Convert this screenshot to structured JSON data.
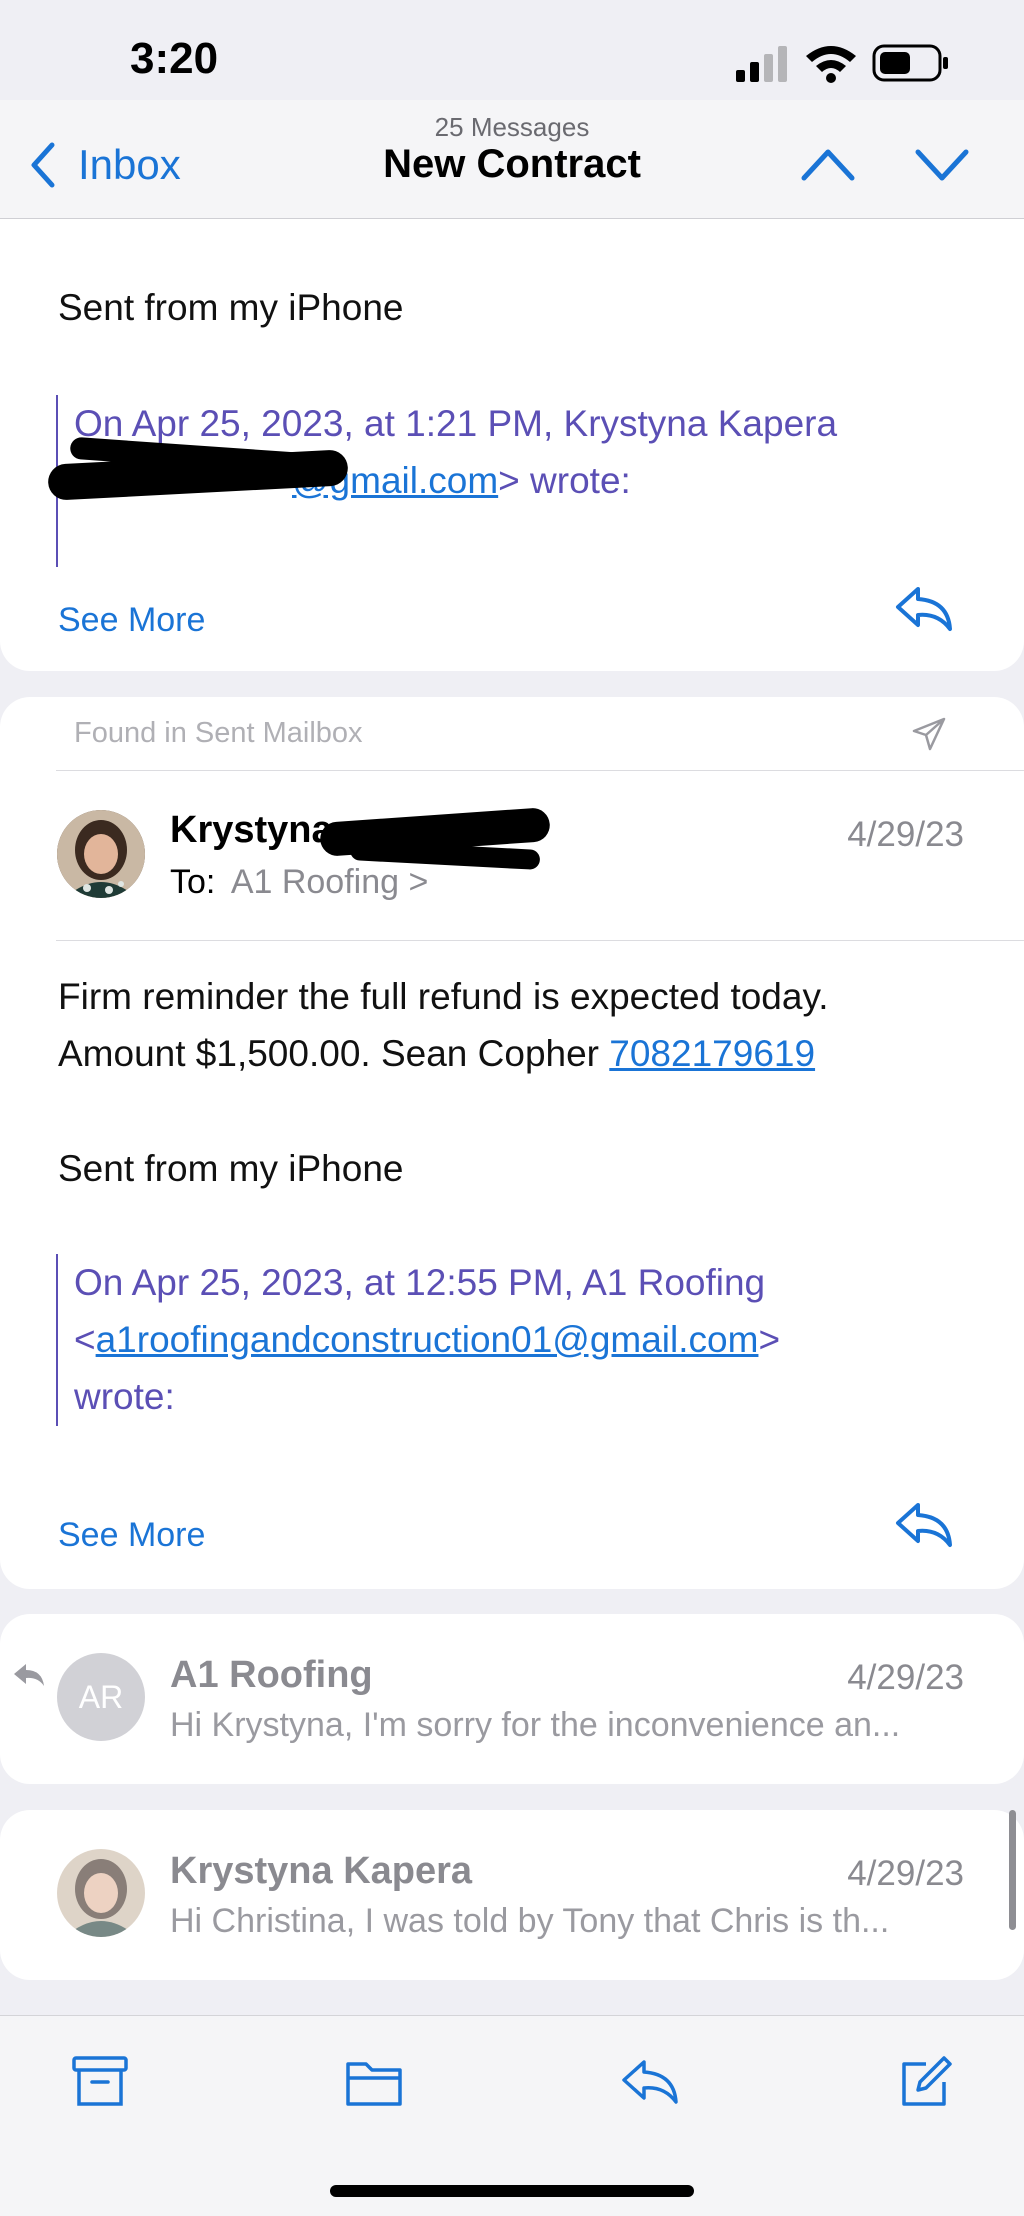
{
  "status": {
    "time": "3:20"
  },
  "nav": {
    "back_label": "Inbox",
    "message_count": "25 Messages",
    "title": "New Contract"
  },
  "msg1": {
    "signature": "Sent from my iPhone",
    "quote_line1": "On Apr 25, 2023, at 1:21 PM, Krystyna Kapera",
    "quote_link": "@gmail.com",
    "quote_tail": "> wrote:",
    "see_more": "See More"
  },
  "msg2": {
    "found_in": "Found in Sent Mailbox",
    "sender": "Krystyna",
    "date": "4/29/23",
    "to_label": "To:",
    "to_value": "A1 Roofing >",
    "body_line1": "Firm reminder the full refund is expected today.",
    "body_line2": "Amount $1,500.00. Sean Copher ",
    "phone": "7082179619",
    "signature": "Sent from my iPhone",
    "quote_line1": "On Apr 25, 2023, at 12:55 PM, A1 Roofing",
    "quote_lt": "<",
    "quote_email": "a1roofingandconstruction01@gmail.com",
    "quote_gt": ">",
    "quote_line3": "wrote:",
    "see_more": "See More"
  },
  "msg3": {
    "avatar_initials": "AR",
    "sender": "A1 Roofing",
    "date": "4/29/23",
    "preview": "Hi Krystyna, I'm sorry for the inconvenience an..."
  },
  "msg4": {
    "sender": "Krystyna Kapera",
    "date": "4/29/23",
    "preview": "Hi Christina, I was told by Tony that Chris is th..."
  },
  "colors": {
    "accent": "#1a74d6",
    "quote": "#5b4fb5"
  }
}
